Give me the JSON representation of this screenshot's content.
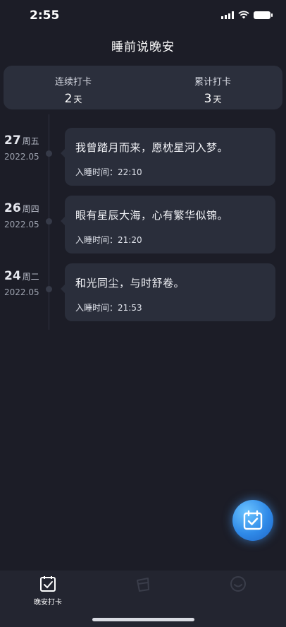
{
  "status_bar": {
    "time": "2:55"
  },
  "header": {
    "title": "睡前说晚安"
  },
  "stats": [
    {
      "label": "连续打卡",
      "value": "2",
      "unit": "天"
    },
    {
      "label": "累计打卡",
      "value": "3",
      "unit": "天"
    }
  ],
  "entries": [
    {
      "day": "27",
      "weekday": "周五",
      "year_month": "2022.05",
      "quote": "我曾踏月而来，愿枕星河入梦。",
      "sleep_time": "入睡时间：22:10"
    },
    {
      "day": "26",
      "weekday": "周四",
      "year_month": "2022.05",
      "quote": "眼有星辰大海，心有繁华似锦。",
      "sleep_time": "入睡时间：21:20"
    },
    {
      "day": "24",
      "weekday": "周二",
      "year_month": "2022.05",
      "quote": "和光同尘，与时舒卷。",
      "sleep_time": "入睡时间：21:53"
    }
  ],
  "tabs": [
    {
      "label": "晚安打卡",
      "icon": "checkin-icon",
      "active": true
    },
    {
      "label": "",
      "icon": "cup-icon",
      "active": false
    },
    {
      "label": "",
      "icon": "smile-icon",
      "active": false
    }
  ],
  "fab": {
    "icon": "calendar-check-icon"
  },
  "colors": {
    "background": "#1c1d27",
    "card": "#2a2e3b",
    "accent": "#2f8ae8"
  }
}
